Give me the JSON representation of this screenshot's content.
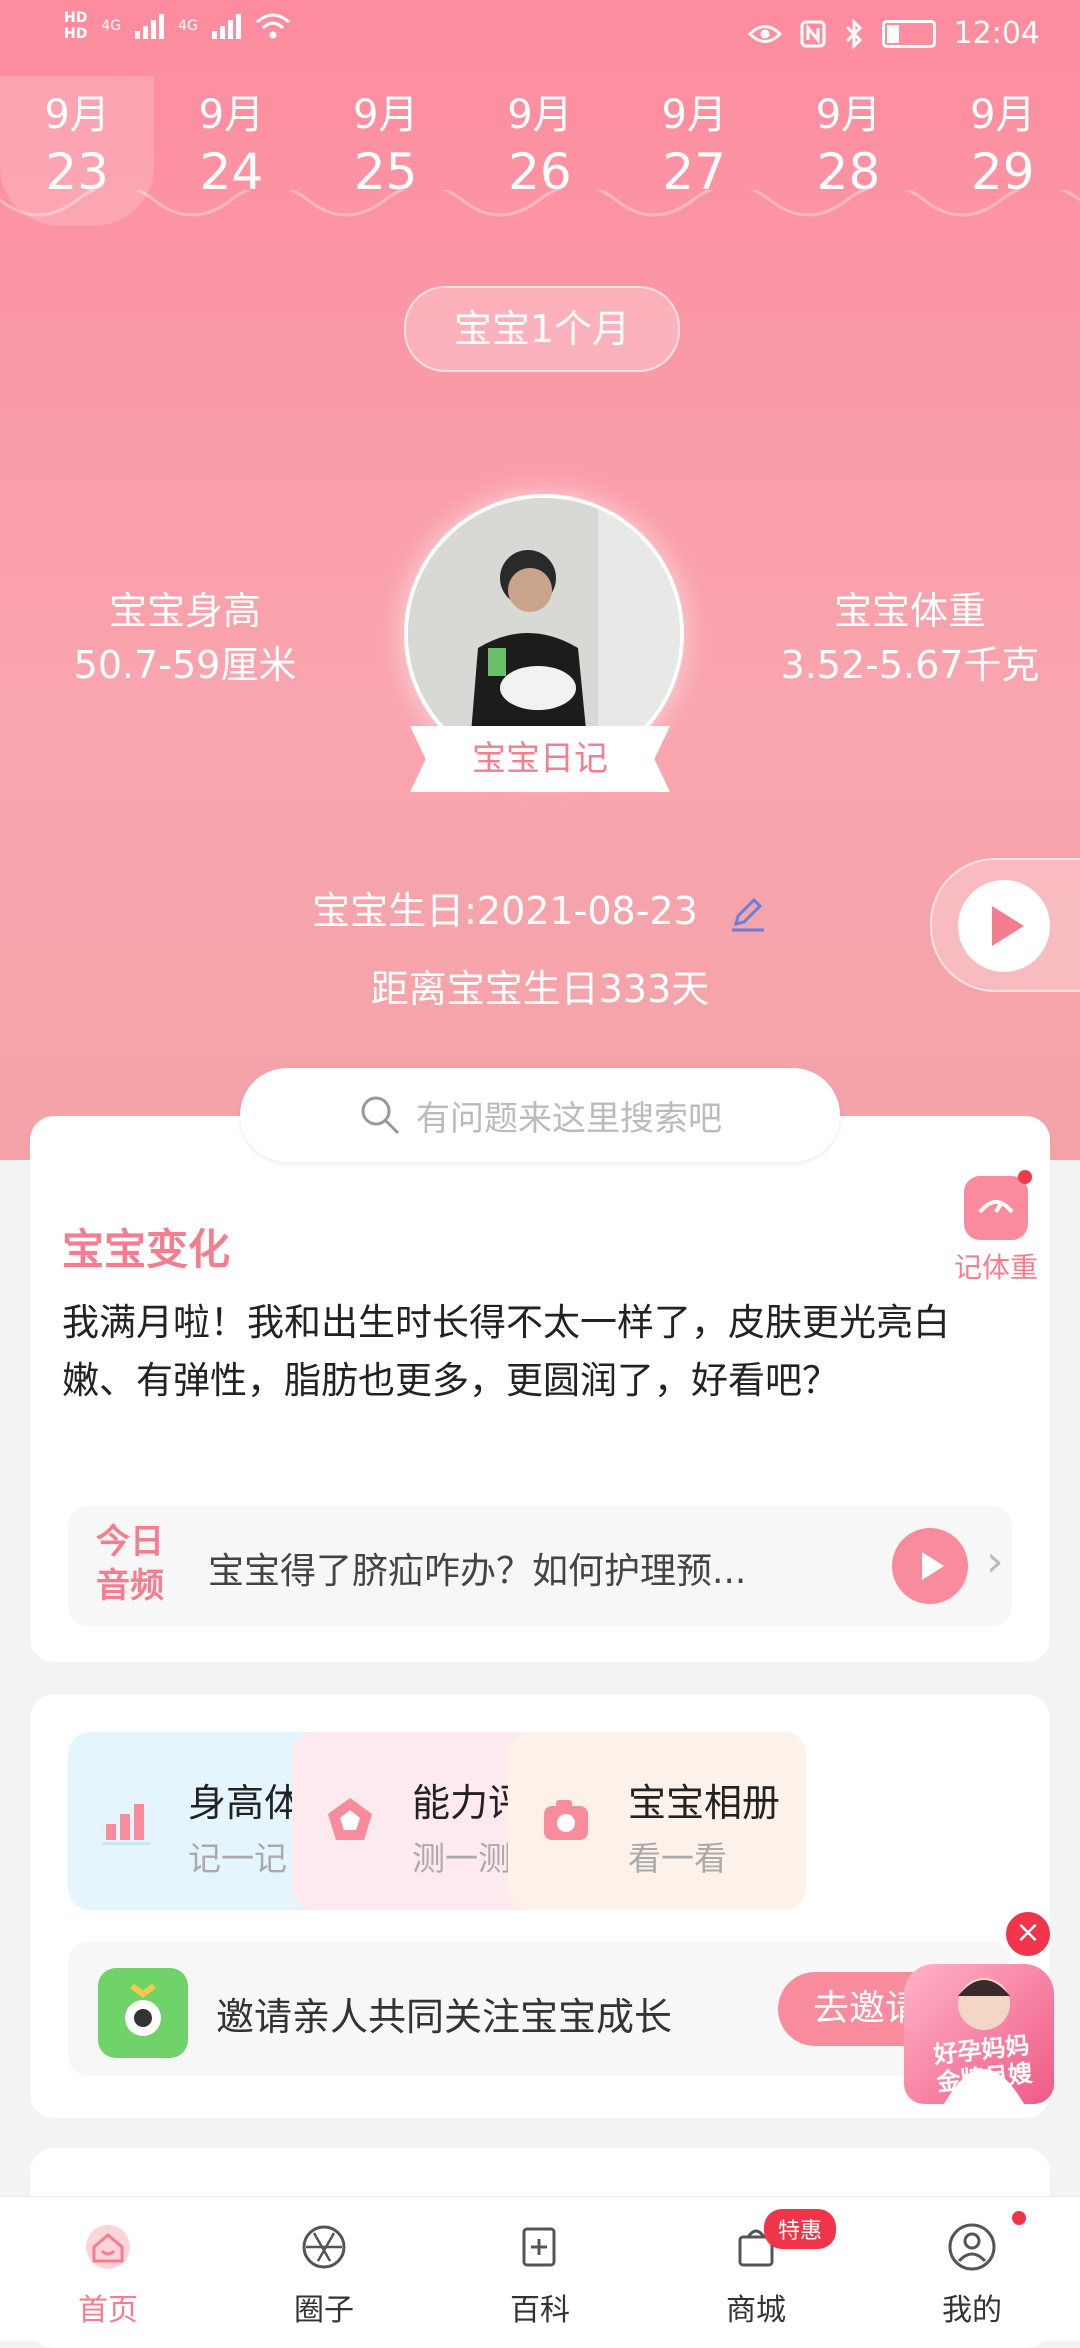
{
  "status": {
    "hd1": "HD",
    "hd2": "HD",
    "net1": "4G",
    "net2": "4G",
    "time": "12:04"
  },
  "dates": [
    {
      "month": "9月",
      "day": "23",
      "active": true
    },
    {
      "month": "9月",
      "day": "24"
    },
    {
      "month": "9月",
      "day": "25"
    },
    {
      "month": "9月",
      "day": "26"
    },
    {
      "month": "9月",
      "day": "27"
    },
    {
      "month": "9月",
      "day": "28"
    },
    {
      "month": "9月",
      "day": "29"
    }
  ],
  "hero": {
    "age_label": "宝宝1个月",
    "height_title": "宝宝身高",
    "height_value": "50.7-59厘米",
    "weight_title": "宝宝体重",
    "weight_value": "3.52-5.67千克",
    "diary_label": "宝宝日记",
    "birthday": "宝宝生日:2021-08-23",
    "countdown": "距离宝宝生日333天"
  },
  "search": {
    "placeholder": "有问题来这里搜索吧"
  },
  "change_card": {
    "title": "宝宝变化",
    "weigh_label": "记体重",
    "description": "我满月啦！我和出生时长得不太一样了，皮肤更光亮白嫩、有弹性，脂肪也更多，更圆润了，好看吧？",
    "audio_tag": "今日音频",
    "audio_title": "宝宝得了脐疝咋办？如何护理预..."
  },
  "tools": [
    {
      "title": "身高体重",
      "sub": "记一记",
      "bg": "#e5f5fd"
    },
    {
      "title": "能力评测",
      "sub": "测一测",
      "bg": "#fdeaee"
    },
    {
      "title": "宝宝相册",
      "sub": "看一看",
      "bg": "#fdf2ea"
    }
  ],
  "invite": {
    "text": "邀请亲人共同关注宝宝成长",
    "button": "去邀请"
  },
  "promo": {
    "line1": "好孕妈妈",
    "line2": "金牌月嫂"
  },
  "tabs": [
    {
      "label": "首页",
      "icon": "home-icon",
      "active": true
    },
    {
      "label": "圈子",
      "icon": "aperture-icon"
    },
    {
      "label": "百科",
      "icon": "book-icon"
    },
    {
      "label": "商城",
      "icon": "shopping-bag-icon",
      "badge": "特惠"
    },
    {
      "label": "我的",
      "icon": "person-icon",
      "dot": true
    }
  ],
  "colors": {
    "accent": "#f47e90",
    "hero_top": "#fd8c9e",
    "badge": "#f0344a"
  }
}
